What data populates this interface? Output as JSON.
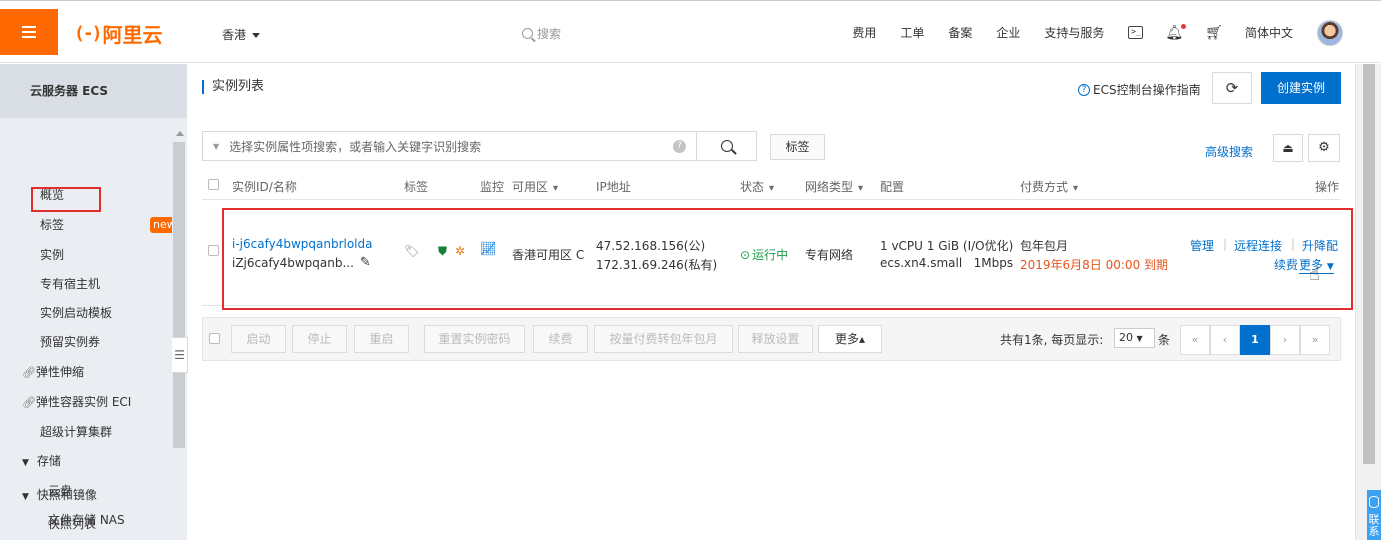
{
  "topbar": {
    "logo": "阿里云",
    "logo_mark": "(-)",
    "region": "香港",
    "search_placeholder": "搜索",
    "nav": [
      "费用",
      "工单",
      "备案",
      "企业",
      "支持与服务"
    ],
    "language": "简体中文"
  },
  "sidebar": {
    "title": "云服务器 ECS",
    "items": {
      "overview": "概览",
      "tags": "标签",
      "instances": "实例",
      "dedicated_hosts": "专有宿主机",
      "launch_templates": "实例启动模板",
      "reserved_instances": "预留实例券",
      "new_badge": "new",
      "auto_scaling": "弹性伸缩",
      "eci": "弹性容器实例 ECI",
      "super_computing": "超级计算集群",
      "storage": "存储",
      "cloud_disk": "云盘",
      "nas": "文件存储 NAS",
      "snapshots": "快照和镜像",
      "snapshot_list": "快照列表"
    }
  },
  "main": {
    "page_title": "实例列表",
    "guide_link": "ECS控制台操作指南",
    "create_button": "创建实例",
    "filter_placeholder": "选择实例属性项搜索，或者输入关键字识别搜索",
    "tag_button": "标签",
    "advanced_search": "高级搜索"
  },
  "table": {
    "columns": {
      "id_name": "实例ID/名称",
      "tags": "标签",
      "monitor": "监控",
      "zone": "可用区",
      "ip": "IP地址",
      "status": "状态",
      "network": "网络类型",
      "config": "配置",
      "billing": "付费方式",
      "actions": "操作"
    },
    "rows": [
      {
        "instance_id": "i-j6cafy4bwpqanbrlolda",
        "instance_name": "iZj6cafy4bwpqanb...",
        "zone": "香港可用区 C",
        "public_ip": "47.52.168.156(公)",
        "private_ip": "172.31.69.246(私有)",
        "status": "运行中",
        "network": "专有网络",
        "config_line1": "1 vCPU 1 GiB (I/O优化)",
        "config_line2": "ecs.xn4.small   1Mbps",
        "billing_type": "包年包月",
        "expiry": "2019年6月8日 00:00 到期",
        "actions": {
          "manage": "管理",
          "remote": "远程连接",
          "upgrade": "升降配",
          "renew": "续费",
          "more": "更多"
        }
      }
    ]
  },
  "bulk_actions": {
    "start": "启动",
    "stop": "停止",
    "restart": "重启",
    "reset_password": "重置实例密码",
    "renew": "续费",
    "convert": "按量付费转包年包月",
    "release": "释放设置",
    "more": "更多▴"
  },
  "pagination": {
    "summary": "共有1条, 每页显示:",
    "page_size": "20",
    "unit": "条",
    "first": "«",
    "prev": "‹",
    "current": "1",
    "next": "›",
    "last": "»"
  },
  "float_widget": {
    "label": "联系"
  }
}
